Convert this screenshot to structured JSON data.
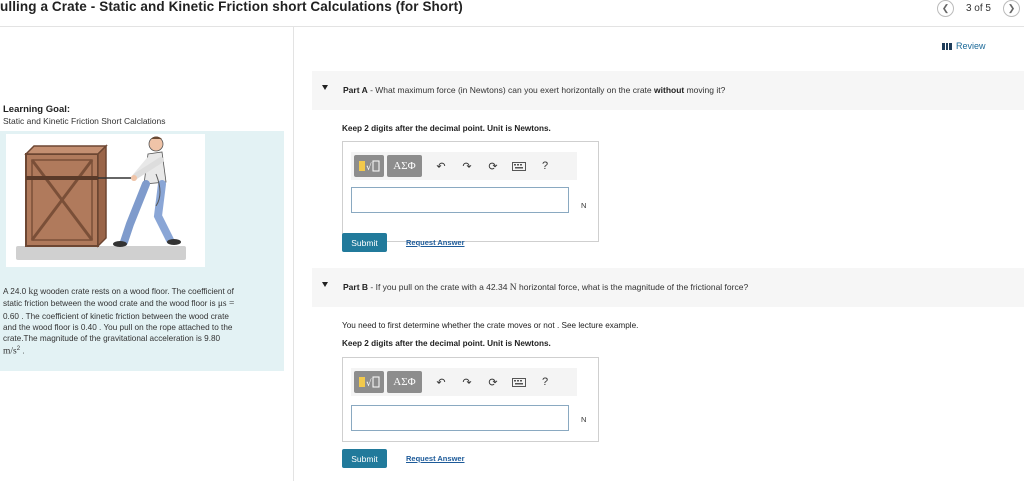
{
  "header": {
    "title": "ulling a Crate - Static and Kinetic Friction short Calculations (for Short)",
    "page_indicator": "3 of 5",
    "prev_icon": "chevron-left-icon",
    "next_icon": "chevron-right-icon"
  },
  "review": {
    "label": "Review",
    "icon": "review-bars-icon"
  },
  "learning_goal": {
    "heading": "Learning Goal:",
    "text": "Static and Kinetic Friction Short Calclations",
    "figure": "man-pulling-crate-illustration",
    "problem": {
      "line1_a": "A 24.0",
      "kg": "kg",
      "line1_b": "wooden crate rests on a wood floor. The coefficient of",
      "line2": "static friction between the wood crate and the wood floor is",
      "mu_s": "μs =",
      "line3": "0.60 . The coefficient of kinetic friction between the wood crate",
      "line4": "and the wood floor is 0.40 . You pull on the rope attached to the",
      "line5": "crate.The magnitude of the gravitational acceleration is 9.80",
      "unit": "m/s",
      "sup": "2",
      "end": " ."
    }
  },
  "part_a": {
    "label": "Part A",
    "question_a": " - What maximum force (in Newtons) can you exert horizontally on the crate ",
    "question_bold": "without",
    "question_b": " moving it?",
    "instruction": "Keep 2 digits after the decimal point.  Unit is Newtons.",
    "unit": "N",
    "answer_value": "",
    "submit": "Submit",
    "request": "Request Answer"
  },
  "part_b": {
    "label": "Part B",
    "question_a": " - If you pull on the crate with a 42.34 ",
    "question_unit": "N",
    "question_b": " horizontal force, what is the magnitude of the frictional force?",
    "note": "You need to first determine whether the crate moves or not . See lecture example.",
    "instruction": "Keep 2 digits after the decimal point.  Unit is Newtons.",
    "unit": "N",
    "answer_value": "",
    "submit": "Submit",
    "request": "Request Answer"
  },
  "toolbar": {
    "templates_icon": "templates-icon",
    "symbols": "ΑΣΦ",
    "undo_icon": "undo-icon",
    "redo_icon": "redo-icon",
    "reset_icon": "reset-icon",
    "keyboard_icon": "keyboard-icon",
    "help": "?"
  }
}
